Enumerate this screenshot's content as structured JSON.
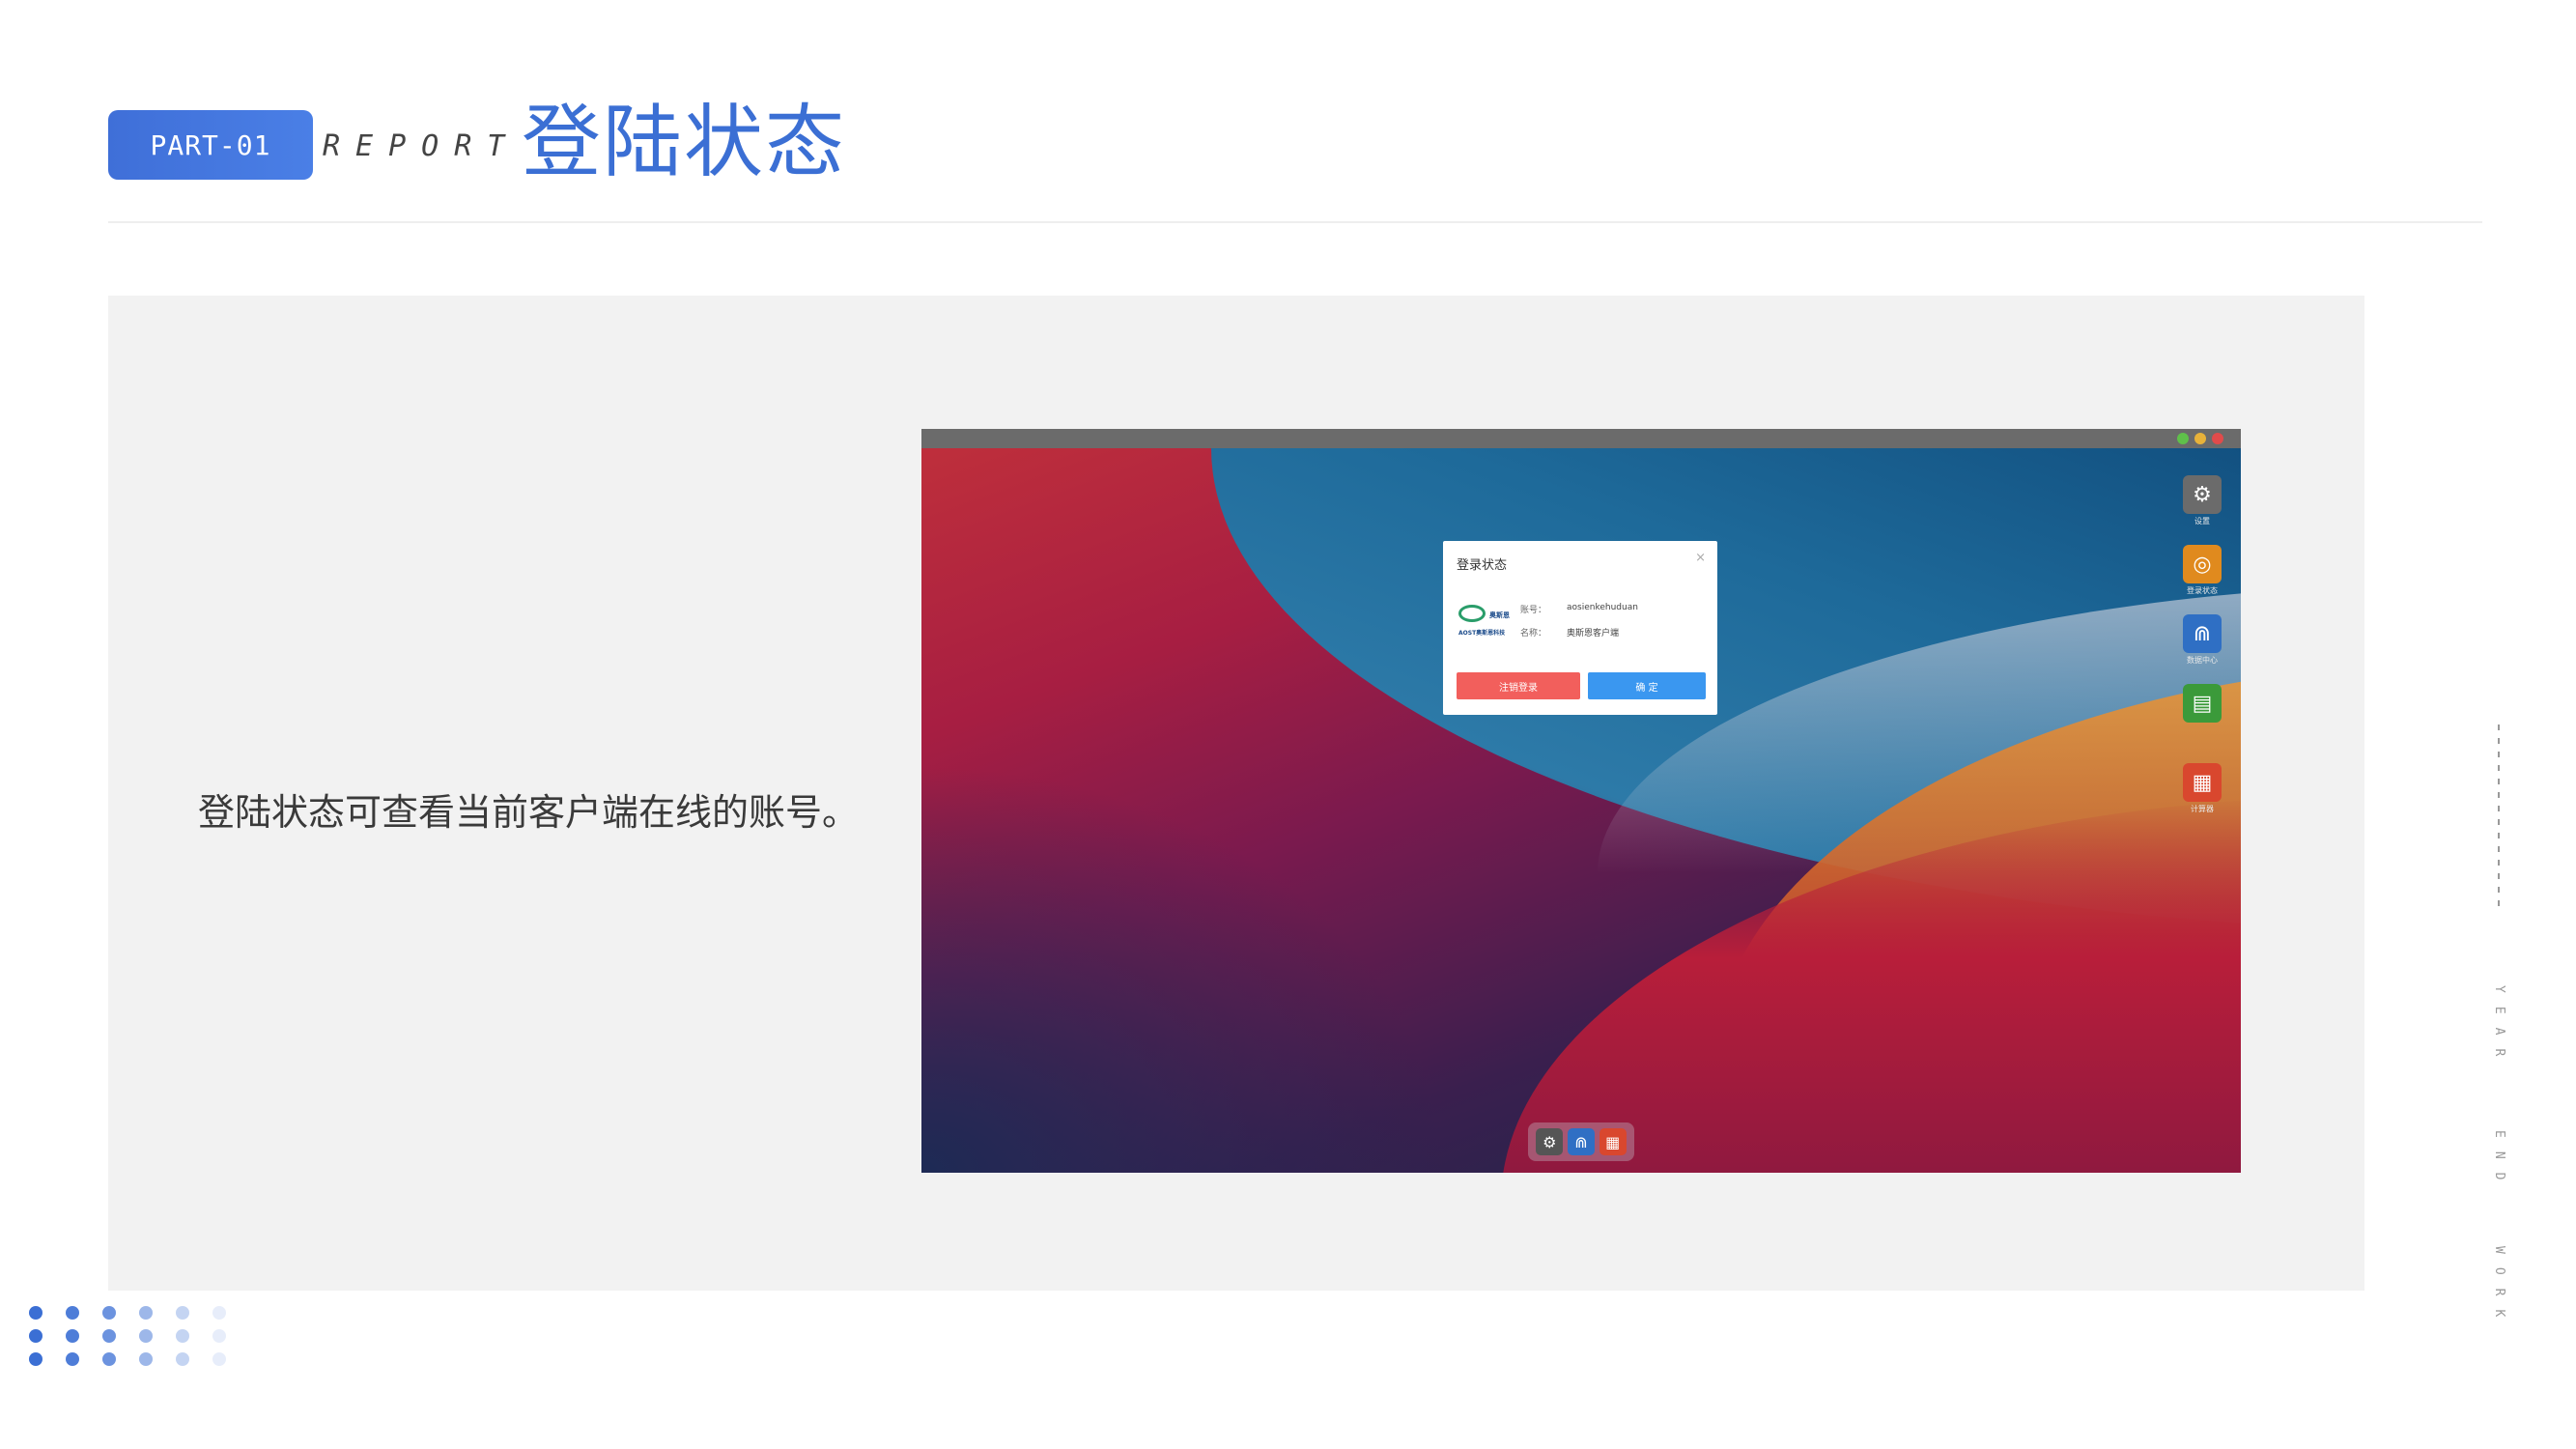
{
  "header": {
    "part_label": "PART-01",
    "report_label": "REPORT",
    "title": "登陆状态"
  },
  "content": {
    "description": "登陆状态可查看当前客户端在线的账号。"
  },
  "screenshot": {
    "dialog": {
      "title": "登录状态",
      "close_icon": "×",
      "logo_text": "奥斯恩",
      "logo_sub": "AOST奥斯恩科技",
      "account_label": "账号：",
      "account_value": "aosienkehuduan",
      "name_label": "名称：",
      "name_value": "奥斯恩客户端",
      "logout_button": "注销登录",
      "ok_button": "确 定"
    },
    "side_icons": [
      {
        "name": "settings",
        "label": "设置",
        "color": "#6b6b6b",
        "glyph": "⚙"
      },
      {
        "name": "login-status",
        "label": "登录状态",
        "color": "#e08a1e",
        "glyph": "◎"
      },
      {
        "name": "data-center",
        "label": "数据中心",
        "color": "#2f6fc4",
        "glyph": "⋒"
      },
      {
        "name": "records",
        "label": "",
        "color": "#3b9a3a",
        "glyph": "▤"
      },
      {
        "name": "calculator",
        "label": "计算器",
        "color": "#d9472e",
        "glyph": "▦"
      }
    ],
    "dock_icons": [
      {
        "name": "settings",
        "color": "#555",
        "glyph": "⚙"
      },
      {
        "name": "data-center",
        "color": "#2f6fc4",
        "glyph": "⋒"
      },
      {
        "name": "calculator",
        "color": "#d9472e",
        "glyph": "▦"
      }
    ]
  },
  "side_decoration": {
    "text_1": "YEAR",
    "text_2": "END",
    "text_3": "WORK"
  },
  "colors": {
    "accent": "#3b6fd4",
    "panel": "#f2f2f2"
  }
}
